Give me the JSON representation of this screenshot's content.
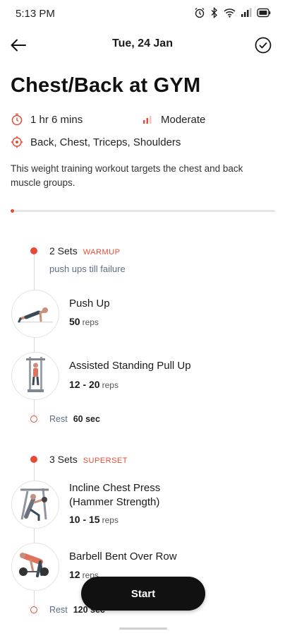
{
  "status_bar": {
    "time": "5:13 PM"
  },
  "header": {
    "date": "Tue, 24 Jan"
  },
  "workout": {
    "title": "Chest/Back at GYM",
    "duration": "1 hr 6 mins",
    "intensity": "Moderate",
    "muscles": "Back, Chest, Triceps, Shoulders",
    "description": "This weight training workout targets the chest and back muscle groups."
  },
  "progress": {
    "fraction": 0.0
  },
  "blocks": [
    {
      "sets": "2 Sets",
      "tag": "WARMUP",
      "note": "push ups till failure",
      "exercises": [
        {
          "name": "Push Up",
          "reps": "50",
          "unit": "reps"
        },
        {
          "name": "Assisted Standing Pull Up",
          "reps": "12 - 20",
          "unit": "reps"
        }
      ],
      "rest": {
        "label": "Rest",
        "value": "60 sec"
      }
    },
    {
      "sets": "3 Sets",
      "tag": "SUPERSET",
      "exercises": [
        {
          "name_line1": "Incline Chest Press",
          "name_line2": "(Hammer Strength)",
          "reps": "10 - 15",
          "unit": "reps"
        },
        {
          "name": "Barbell Bent Over Row",
          "reps": "12",
          "unit": "reps"
        }
      ],
      "rest": {
        "label": "Rest",
        "value": "120 sec"
      }
    }
  ],
  "actions": {
    "start": "Start"
  },
  "colors": {
    "accent": "#e94a35",
    "text": "#1a1a1a",
    "muted": "#5a6e86",
    "button": "#111111"
  }
}
